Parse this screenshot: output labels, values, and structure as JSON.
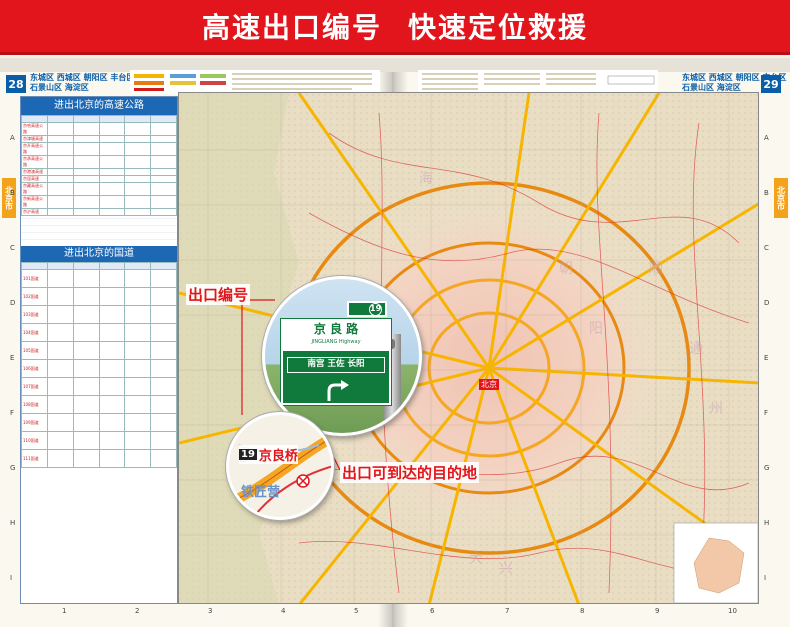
{
  "banner": {
    "left": "高速出口编号",
    "right": "快速定位救援"
  },
  "left_page": {
    "page_number": "28",
    "districts_line1": "东城区 西城区 朝阳区 丰台区",
    "districts_line2": "石景山区 海淀区",
    "side_tab": "北京市",
    "table_title_highways": "进出北京的高速公路",
    "table_title_national": "进出北京的国道",
    "highway_rows": [
      "京哈高速公路",
      "京津塘高速",
      "京开高速公路",
      "京承高速公路",
      "京港澳高速",
      "京昆高速",
      "京藏高速公路",
      "京新高速公路",
      "京沪高速"
    ],
    "national_rows": [
      "101国道",
      "102国道",
      "103国道",
      "104国道",
      "105国道",
      "106国道",
      "107国道",
      "108国道",
      "109国道",
      "110国道",
      "111国道"
    ]
  },
  "right_page": {
    "page_number": "29",
    "districts_line1": "东城区 西城区 朝阳区 丰台区",
    "districts_line2": "石景山区 海淀区",
    "side_tab": "北京市"
  },
  "map": {
    "center_label": "北京",
    "sign": {
      "road_cn": "京 良 路",
      "road_en": "JINGLIANG Highway",
      "destinations": "南宫 王佐 长阳",
      "exit_number": "19"
    },
    "bridge": {
      "number": "19",
      "name": "京良桥"
    },
    "town_label": "铁匠营",
    "row_letters": [
      "A",
      "B",
      "C",
      "D",
      "E",
      "F",
      "G",
      "H",
      "I"
    ],
    "col_numbers": [
      "1",
      "2",
      "3",
      "4",
      "5",
      "6",
      "7",
      "8",
      "9",
      "10"
    ]
  },
  "callouts": {
    "exit_number_label": "出口编号",
    "destination_label": "出口可到达的目的地"
  },
  "colors": {
    "banner": "#e2141c",
    "sign_green": "#0f7a3c",
    "page_blue": "#0a5ea8",
    "callout_red": "#e2141c"
  }
}
